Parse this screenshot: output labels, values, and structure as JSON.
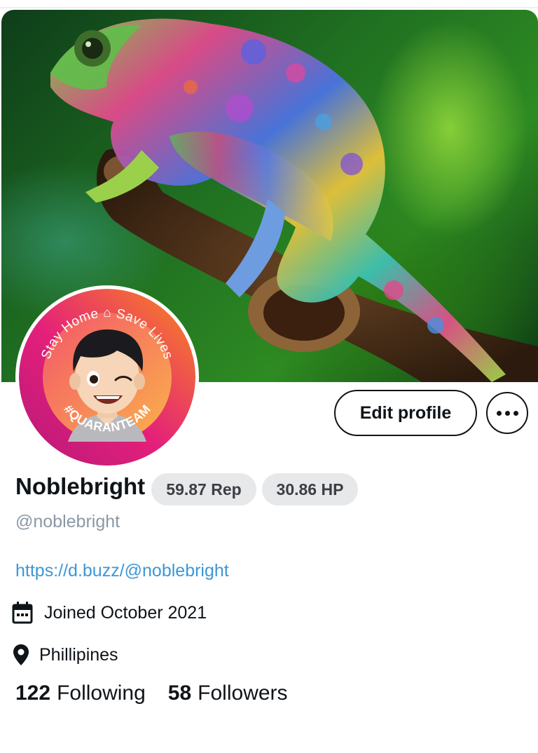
{
  "profile": {
    "display_name": "Noblebright",
    "handle": "@noblebright",
    "reputation_badge": "59.87 Rep",
    "hp_badge": "30.86 HP",
    "website": "https://d.buzz/@noblebright",
    "joined": "Joined October 2021",
    "location": "Phillipines",
    "following_count": "122",
    "following_label": "Following",
    "followers_count": "58",
    "followers_label": "Followers"
  },
  "actions": {
    "edit_profile_label": "Edit profile",
    "more_icon": "more-horizontal-icon"
  },
  "avatar": {
    "frame_text_top": "Stay Home ⌂ Save Lives",
    "frame_text_bottom": "#QUARANTEAM"
  },
  "banner": {
    "subject": "chameleon-banner-image"
  },
  "icons": {
    "calendar": "calendar-icon",
    "location": "location-pin-icon"
  },
  "colors": {
    "text": "#0f1419",
    "muted": "#8b98a5",
    "link": "#3d97d6",
    "badge_bg": "#e6e8ea"
  }
}
